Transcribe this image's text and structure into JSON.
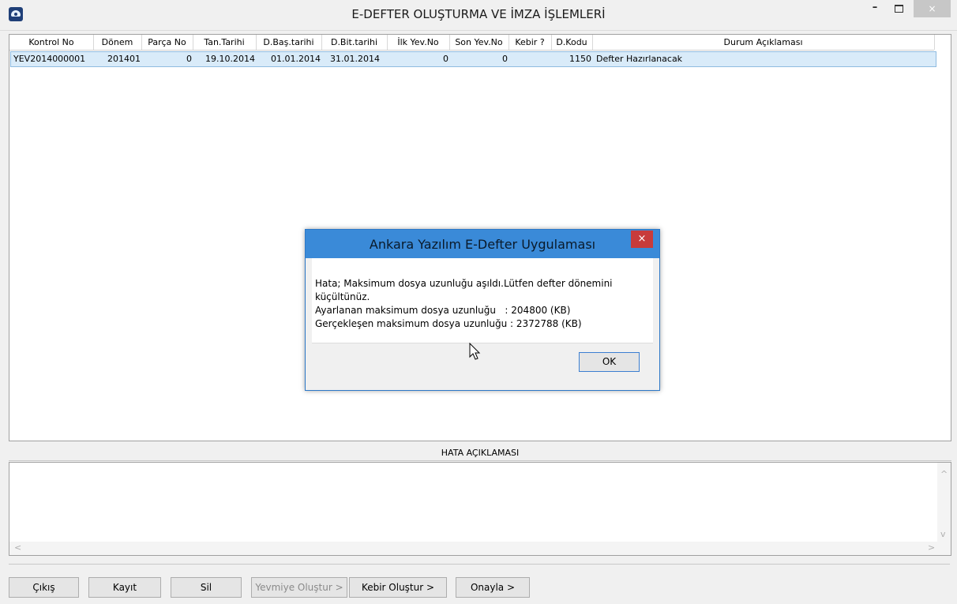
{
  "window": {
    "title": "E-DEFTER OLUŞTURMA VE İMZA İŞLEMLERİ",
    "minimize_label": "–",
    "close_label": "×"
  },
  "grid": {
    "columns": [
      "Kontrol No",
      "Dönem",
      "Parça No",
      "Tan.Tarihi",
      "D.Baş.tarihi",
      "D.Bit.tarihi",
      "İlk Yev.No",
      "Son Yev.No",
      "Kebir ?",
      "D.Kodu",
      "Durum Açıklaması"
    ],
    "rows": [
      {
        "kontrol_no": "YEV2014000001",
        "donem": "201401",
        "parca_no": "0",
        "tan_tarihi": "19.10.2014",
        "d_bas_tarihi": "01.01.2014",
        "d_bit_tarihi": "31.01.2014",
        "ilk_yev_no": "0",
        "son_yev_no": "0",
        "kebir": "",
        "d_kodu": "1150",
        "durum": "Defter Hazırlanacak"
      }
    ]
  },
  "error_section": {
    "label": "HATA AÇIKLAMASI",
    "text": ""
  },
  "buttons": {
    "cikis": "Çıkış",
    "kayit": "Kayıt",
    "sil": "Sil",
    "yevmiye": "Yevmiye Oluştur >",
    "kebir": "Kebir Oluştur >",
    "onayla": "Onayla >"
  },
  "modal": {
    "title": "Ankara Yazılım E-Defter Uygulaması",
    "close_label": "×",
    "lines": [
      "Hata; Maksimum dosya uzunluğu aşıldı.Lütfen defter dönemini",
      "küçültünüz.",
      "Ayarlanan maksimum dosya uzunluğu   : 204800 (KB)",
      "Gerçekleşen maksimum dosya uzunluğu : 2372788 (KB)"
    ],
    "ok_label": "OK"
  }
}
